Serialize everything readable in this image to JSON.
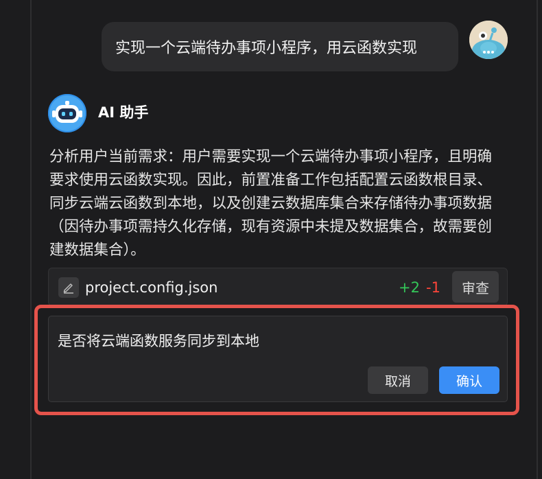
{
  "user_message": {
    "text": "实现一个云端待办事项小程序，用云函数实现"
  },
  "assistant": {
    "name": "AI 助手",
    "analysis": "分析用户当前需求：用户需要实现一个云端待办事项小程序，且明确要求使用云函数实现。因此，前置准备工作包括配置云函数根目录、同步云端云函数到本地，以及创建云数据库集合来存储待办事项数据（因待办事项需持久化存储，现有资源中未提及数据集合，故需要创建数据集合）。"
  },
  "file_change": {
    "icon": "edit-icon",
    "file_name": "project.config.json",
    "additions": "+2",
    "deletions": "-1",
    "review_label": "审查"
  },
  "confirm_dialog": {
    "question": "是否将云端函数服务同步到本地",
    "cancel_label": "取消",
    "confirm_label": "确认"
  },
  "colors": {
    "background": "#1c1c1e",
    "bubble": "#2c2c2e",
    "panel": "#252527",
    "addition": "#34c759",
    "deletion": "#ff453a",
    "primary": "#3a8ef6",
    "highlight": "#e5534b"
  }
}
